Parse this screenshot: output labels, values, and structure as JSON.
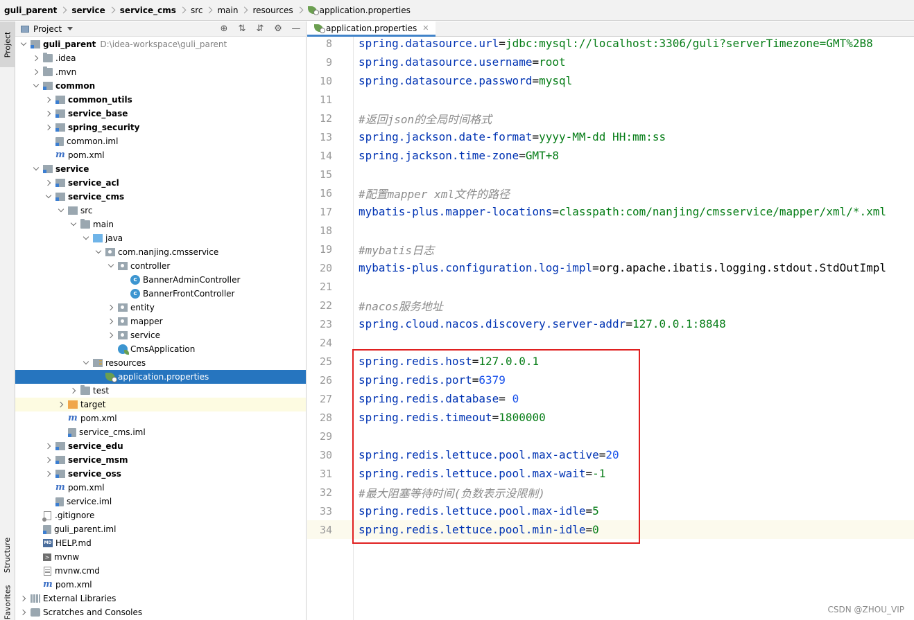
{
  "breadcrumb": [
    {
      "label": "guli_parent",
      "bold": true
    },
    {
      "label": "service",
      "bold": true
    },
    {
      "label": "service_cms",
      "bold": true
    },
    {
      "label": "src",
      "bold": false
    },
    {
      "label": "main",
      "bold": false
    },
    {
      "label": "resources",
      "bold": false
    },
    {
      "label": "application.properties",
      "bold": false,
      "icon": "properties-file-icon"
    }
  ],
  "left_strip": {
    "project_tab": "Project",
    "structure_tab": "Structure",
    "favorites_tab": "Favorites"
  },
  "project_panel": {
    "title": "Project",
    "header_icons": [
      "locate-icon",
      "expand-all-icon",
      "collapse-all-icon",
      "settings-icon",
      "hide-icon"
    ],
    "tree": [
      {
        "depth": 0,
        "arrow": "down",
        "icon": "module",
        "label": "guli_parent",
        "bold": true,
        "path": "D:\\idea-workspace\\guli_parent"
      },
      {
        "depth": 1,
        "arrow": "right",
        "icon": "folder",
        "label": ".idea",
        "bold": false
      },
      {
        "depth": 1,
        "arrow": "right",
        "icon": "folder",
        "label": ".mvn",
        "bold": false
      },
      {
        "depth": 1,
        "arrow": "down",
        "icon": "module",
        "label": "common",
        "bold": true
      },
      {
        "depth": 2,
        "arrow": "right",
        "icon": "module",
        "label": "common_utils",
        "bold": true
      },
      {
        "depth": 2,
        "arrow": "right",
        "icon": "module",
        "label": "service_base",
        "bold": true
      },
      {
        "depth": 2,
        "arrow": "right",
        "icon": "module",
        "label": "spring_security",
        "bold": true
      },
      {
        "depth": 2,
        "arrow": "none",
        "icon": "iml",
        "label": "common.iml",
        "bold": false
      },
      {
        "depth": 2,
        "arrow": "none",
        "icon": "maven",
        "label": "pom.xml",
        "bold": false
      },
      {
        "depth": 1,
        "arrow": "down",
        "icon": "module",
        "label": "service",
        "bold": true
      },
      {
        "depth": 2,
        "arrow": "right",
        "icon": "module",
        "label": "service_acl",
        "bold": true
      },
      {
        "depth": 2,
        "arrow": "down",
        "icon": "module",
        "label": "service_cms",
        "bold": true
      },
      {
        "depth": 3,
        "arrow": "down",
        "icon": "src",
        "label": "src",
        "bold": false
      },
      {
        "depth": 4,
        "arrow": "down",
        "icon": "folder",
        "label": "main",
        "bold": false
      },
      {
        "depth": 5,
        "arrow": "down",
        "icon": "java",
        "label": "java",
        "bold": false
      },
      {
        "depth": 6,
        "arrow": "down",
        "icon": "package",
        "label": "com.nanjing.cmsservice",
        "bold": false
      },
      {
        "depth": 7,
        "arrow": "down",
        "icon": "package",
        "label": "controller",
        "bold": false
      },
      {
        "depth": 8,
        "arrow": "none",
        "icon": "cls",
        "label": "BannerAdminController",
        "bold": false
      },
      {
        "depth": 8,
        "arrow": "none",
        "icon": "cls",
        "label": "BannerFrontController",
        "bold": false
      },
      {
        "depth": 7,
        "arrow": "right",
        "icon": "package",
        "label": "entity",
        "bold": false
      },
      {
        "depth": 7,
        "arrow": "right",
        "icon": "package",
        "label": "mapper",
        "bold": false
      },
      {
        "depth": 7,
        "arrow": "right",
        "icon": "package",
        "label": "service",
        "bold": false
      },
      {
        "depth": 7,
        "arrow": "none",
        "icon": "app",
        "label": "CmsApplication",
        "bold": false
      },
      {
        "depth": 5,
        "arrow": "down",
        "icon": "resources",
        "label": "resources",
        "bold": false
      },
      {
        "depth": 6,
        "arrow": "none",
        "icon": "props",
        "label": "application.properties",
        "bold": false,
        "selected": true
      },
      {
        "depth": 4,
        "arrow": "right",
        "icon": "folder",
        "label": "test",
        "bold": false
      },
      {
        "depth": 3,
        "arrow": "right",
        "icon": "target",
        "label": "target",
        "bold": false,
        "highlight": true
      },
      {
        "depth": 3,
        "arrow": "none",
        "icon": "maven",
        "label": "pom.xml",
        "bold": false
      },
      {
        "depth": 3,
        "arrow": "none",
        "icon": "iml",
        "label": "service_cms.iml",
        "bold": false
      },
      {
        "depth": 2,
        "arrow": "right",
        "icon": "module",
        "label": "service_edu",
        "bold": true
      },
      {
        "depth": 2,
        "arrow": "right",
        "icon": "module",
        "label": "service_msm",
        "bold": true
      },
      {
        "depth": 2,
        "arrow": "right",
        "icon": "module",
        "label": "service_oss",
        "bold": true
      },
      {
        "depth": 2,
        "arrow": "none",
        "icon": "maven",
        "label": "pom.xml",
        "bold": false
      },
      {
        "depth": 2,
        "arrow": "none",
        "icon": "iml",
        "label": "service.iml",
        "bold": false
      },
      {
        "depth": 1,
        "arrow": "none",
        "icon": "gitignore",
        "label": ".gitignore",
        "bold": false
      },
      {
        "depth": 1,
        "arrow": "none",
        "icon": "iml",
        "label": "guli_parent.iml",
        "bold": false
      },
      {
        "depth": 1,
        "arrow": "none",
        "icon": "md",
        "label": "HELP.md",
        "bold": false
      },
      {
        "depth": 1,
        "arrow": "none",
        "icon": "term",
        "label": "mvnw",
        "bold": false
      },
      {
        "depth": 1,
        "arrow": "none",
        "icon": "file",
        "label": "mvnw.cmd",
        "bold": false
      },
      {
        "depth": 1,
        "arrow": "none",
        "icon": "maven",
        "label": "pom.xml",
        "bold": false
      },
      {
        "depth": 0,
        "arrow": "right",
        "icon": "lib",
        "label": "External Libraries",
        "bold": false
      },
      {
        "depth": 0,
        "arrow": "right",
        "icon": "scratch",
        "label": "Scratches and Consoles",
        "bold": false
      }
    ]
  },
  "editor": {
    "tab_label": "application.properties",
    "current_line": 34,
    "lines": [
      {
        "num": "8",
        "key": "spring.datasource.url",
        "val": "jdbc:mysql://localhost:3306/guli?serverTimezone=GMT%2B8",
        "vtype": "str"
      },
      {
        "num": "9",
        "key": "spring.datasource.username",
        "val": "root",
        "vtype": "str"
      },
      {
        "num": "10",
        "key": "spring.datasource.password",
        "val": "mysql",
        "vtype": "str"
      },
      {
        "num": "11"
      },
      {
        "num": "12",
        "comment": "#返回json的全局时间格式"
      },
      {
        "num": "13",
        "key": "spring.jackson.date-format",
        "val": "yyyy-MM-dd HH:mm:ss",
        "vtype": "str"
      },
      {
        "num": "14",
        "key": "spring.jackson.time-zone",
        "val": "GMT+8",
        "vtype": "str"
      },
      {
        "num": "15"
      },
      {
        "num": "16",
        "comment": "#配置mapper xml文件的路径"
      },
      {
        "num": "17",
        "key": "mybatis-plus.mapper-locations",
        "val": "classpath:com/nanjing/cmsservice/mapper/xml/*.xml",
        "vtype": "str"
      },
      {
        "num": "18"
      },
      {
        "num": "19",
        "comment": "#mybatis日志"
      },
      {
        "num": "20",
        "key": "mybatis-plus.configuration.log-impl",
        "val": "org.apache.ibatis.logging.stdout.StdOutImpl",
        "vtype": "plain"
      },
      {
        "num": "21"
      },
      {
        "num": "22",
        "comment": "#nacos服务地址"
      },
      {
        "num": "23",
        "key": "spring.cloud.nacos.discovery.server-addr",
        "val": "127.0.0.1:8848",
        "vtype": "str"
      },
      {
        "num": "24"
      },
      {
        "num": "25",
        "key": "spring.redis.host",
        "val": "127.0.0.1",
        "vtype": "str"
      },
      {
        "num": "26",
        "key": "spring.redis.port",
        "val": "6379",
        "vtype": "num"
      },
      {
        "num": "27",
        "key": "spring.redis.database",
        "val": " 0",
        "vtype": "num"
      },
      {
        "num": "28",
        "key": "spring.redis.timeout",
        "val": "1800000",
        "vtype": "str"
      },
      {
        "num": "29"
      },
      {
        "num": "30",
        "key": "spring.redis.lettuce.pool.max-active",
        "val": "20",
        "vtype": "num"
      },
      {
        "num": "31",
        "key": "spring.redis.lettuce.pool.max-wait",
        "val": "-1",
        "vtype": "str"
      },
      {
        "num": "32",
        "comment": "#最大阻塞等待时间(负数表示没限制)"
      },
      {
        "num": "33",
        "key": "spring.redis.lettuce.pool.max-idle",
        "val": "5",
        "vtype": "str"
      },
      {
        "num": "34",
        "key": "spring.redis.lettuce.pool.min-idle",
        "val": "0",
        "vtype": "str"
      }
    ]
  },
  "watermark": "CSDN @ZHOU_VIP",
  "colors": {
    "key": "#0033b3",
    "string_value": "#067d17",
    "number_value": "#1750eb",
    "comment": "#8c8c8c",
    "selection": "#2675bf",
    "annotation_box": "#e02020"
  }
}
